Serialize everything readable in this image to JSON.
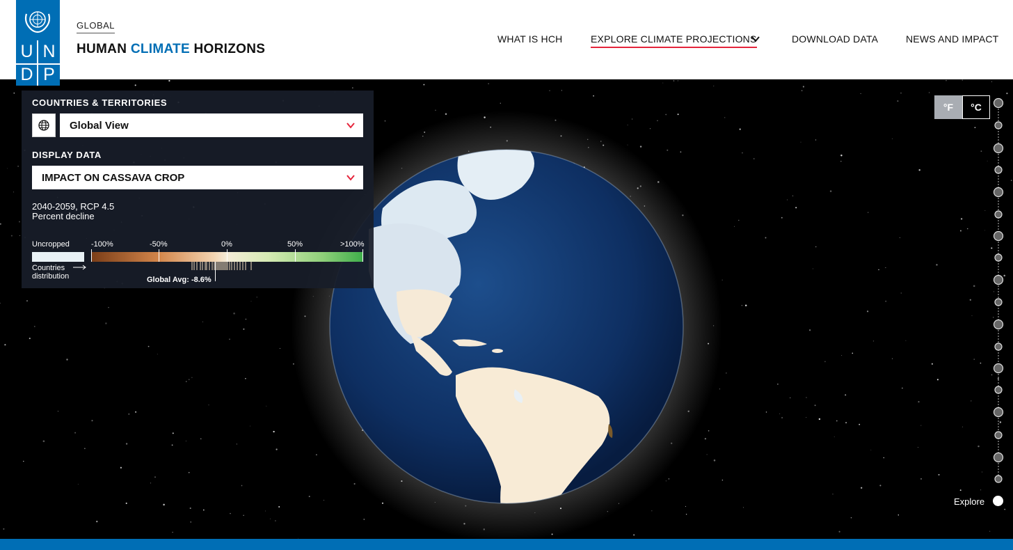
{
  "header": {
    "logo_letters": [
      "U",
      "N",
      "D",
      "P"
    ],
    "kicker": "GLOBAL",
    "title_part1": "HUMAN",
    "title_part2": "CLIMATE",
    "title_part3": "HORIZONS",
    "nav": [
      {
        "label": "WHAT IS HCH"
      },
      {
        "label": "EXPLORE CLIMATE PROJECTIONS"
      },
      {
        "label": "DOWNLOAD DATA"
      },
      {
        "label": "NEWS AND IMPACT"
      }
    ]
  },
  "panel": {
    "countries_label": "COUNTRIES & TERRITORIES",
    "country_select": "Global View",
    "display_label": "DISPLAY DATA",
    "display_select": "IMPACT ON CASSAVA CROP",
    "period": "2040-2059, RCP 4.5",
    "unit": "Percent decline",
    "legend": {
      "uncropped": "Uncropped",
      "ticks": [
        "-100%",
        "-50%",
        "0%",
        "50%",
        ">100%"
      ],
      "countries": "Countries",
      "distribution": "distribution",
      "global_avg": "Global Avg: -8.6%"
    }
  },
  "temperature": {
    "f": "°F",
    "c": "°C",
    "selected": "°C"
  },
  "explore_label": "Explore",
  "colors": {
    "brand_blue": "#006eb5",
    "accent_red": "#e5243b",
    "panel_bg": "#181d29"
  }
}
